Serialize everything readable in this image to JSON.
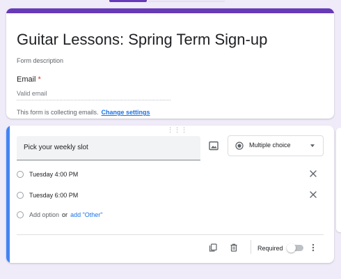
{
  "colors": {
    "theme": "#673ab7",
    "active_question": "#4285f4",
    "link": "#1a73e8",
    "required": "#d93025",
    "background": "#f0ebf8"
  },
  "form": {
    "title": "Guitar Lessons: Spring Term Sign-up",
    "description_placeholder": "Form description",
    "email": {
      "label": "Email",
      "required_marker": "*",
      "placeholder": "Valid email"
    },
    "collecting_notice": "This form is collecting emails.",
    "change_settings_link": "Change settings"
  },
  "question": {
    "title": "Pick your weekly slot",
    "image_icon": "image-icon",
    "type": {
      "label": "Multiple choice",
      "icon": "radio-button-checked-icon"
    },
    "options": [
      {
        "label": "Tuesday 4:00 PM"
      },
      {
        "label": "Tuesday 6:00 PM"
      }
    ],
    "add_option_label": "Add option",
    "or_label": "or",
    "add_other_label": "add \"Other\"",
    "footer": {
      "duplicate_icon": "content-copy-icon",
      "delete_icon": "trash-icon",
      "required_label": "Required",
      "required_on": false,
      "more_icon": "more-vertical-icon"
    }
  }
}
